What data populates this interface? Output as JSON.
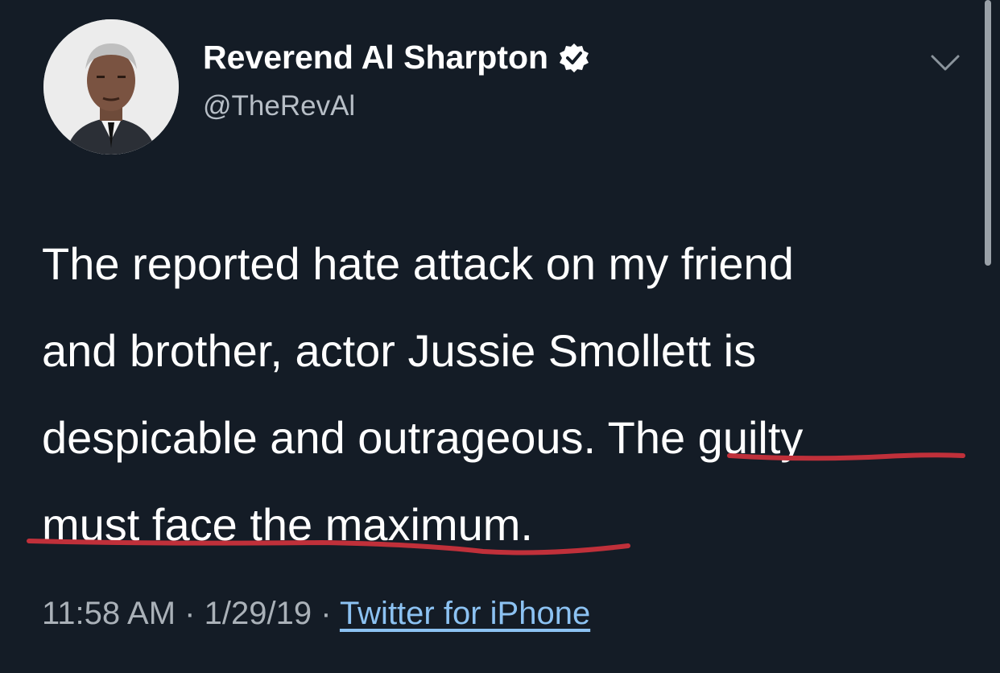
{
  "tweet": {
    "author": {
      "display_name": "Reverend Al Sharpton",
      "handle": "@TheRevAl",
      "verified": true
    },
    "text_lines": [
      "The reported hate attack on my friend",
      "and brother, actor Jussie Smollett is",
      "despicable and outrageous. The guilty",
      "must face the maximum."
    ],
    "time": "11:58 AM",
    "separator": "·",
    "date": "1/29/19",
    "source": "Twitter for iPhone"
  },
  "colors": {
    "background": "#141c26",
    "verified": "#ffffff",
    "link": "#8cc2f2",
    "annotation_underline": "#c0303a"
  },
  "icons": [
    "avatar-photo",
    "verified-badge-icon",
    "chevron-down-icon"
  ]
}
